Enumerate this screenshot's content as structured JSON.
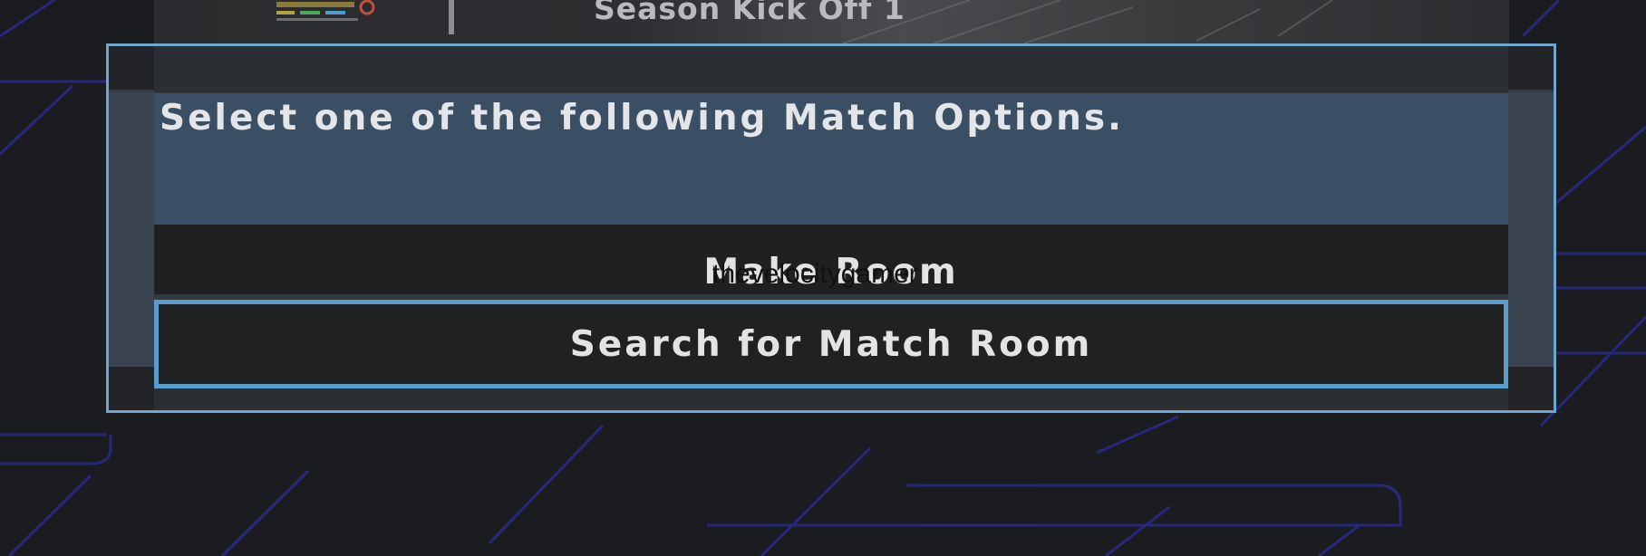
{
  "header": {
    "title": "Season Kick Off 1"
  },
  "dialog": {
    "message": "Select one of the following Match Options.",
    "options": [
      {
        "label": "Make Room",
        "selected": false
      },
      {
        "label": "Search for Match Room",
        "selected": true
      }
    ]
  },
  "watermark": "thevelocitygamer",
  "colors": {
    "background": "#1b1c1f",
    "dialog_border": "#6ea6cf",
    "message_panel": "#3a4f63",
    "option_background": "#1f2022",
    "selected_border": "#5a9ccd",
    "decor_lines": "#2a2a8f"
  }
}
